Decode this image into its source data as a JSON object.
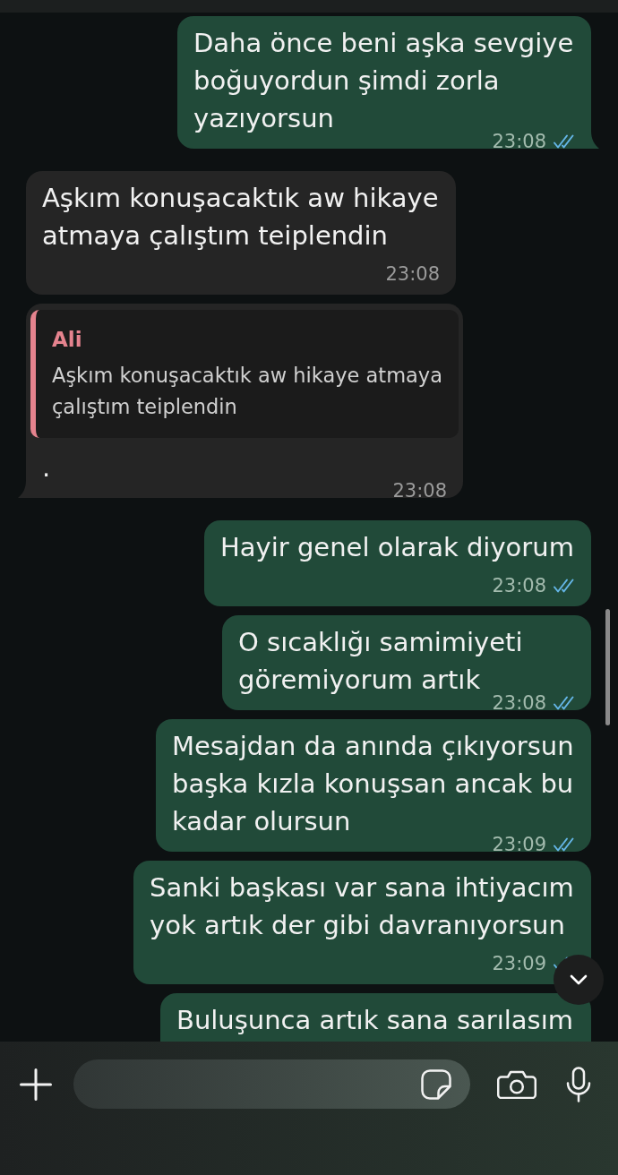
{
  "messages": [
    {
      "kind": "outgoing",
      "text": "Daha önce beni aşka sevgiye boğuyordun şimdi zorla yazıyorsun",
      "time": "23:08",
      "read": true,
      "tail": true,
      "cut_off": false
    },
    {
      "kind": "incoming",
      "text": "Aşkım konuşacaktık aw hikaye atmaya çalıştım teiplendin",
      "time": "23:08",
      "tail": false,
      "cut_off": false
    },
    {
      "kind": "incoming",
      "reply_to": {
        "sender": "Ali",
        "text": "Aşkım konuşacaktık aw hikaye atmaya çalıştım teiplendin"
      },
      "text": ".",
      "time": "23:08",
      "tail": true,
      "cut_off": false
    },
    {
      "kind": "outgoing",
      "text": "Hayir genel olarak diyorum",
      "time": "23:08",
      "read": true,
      "tail": false,
      "cut_off": false
    },
    {
      "kind": "outgoing",
      "text": "O sıcaklığı samimiyeti göremiyorum artık",
      "time": "23:08",
      "read": true,
      "tail": false,
      "cut_off": false
    },
    {
      "kind": "outgoing",
      "text": "Mesajdan da anında çıkıyorsun başka kızla konuşsan ancak bu kadar olursun",
      "time": "23:09",
      "read": true,
      "tail": false,
      "cut_off": false
    },
    {
      "kind": "outgoing",
      "text": "Sanki başkası var sana ihtiyacım yok artık der gibi davranıyorsun",
      "time": "23:09",
      "read": true,
      "tail": false,
      "cut_off": false
    },
    {
      "kind": "outgoing",
      "text": "Buluşunca artık sana sarılasım",
      "tail": false,
      "cut_off": true
    }
  ]
}
